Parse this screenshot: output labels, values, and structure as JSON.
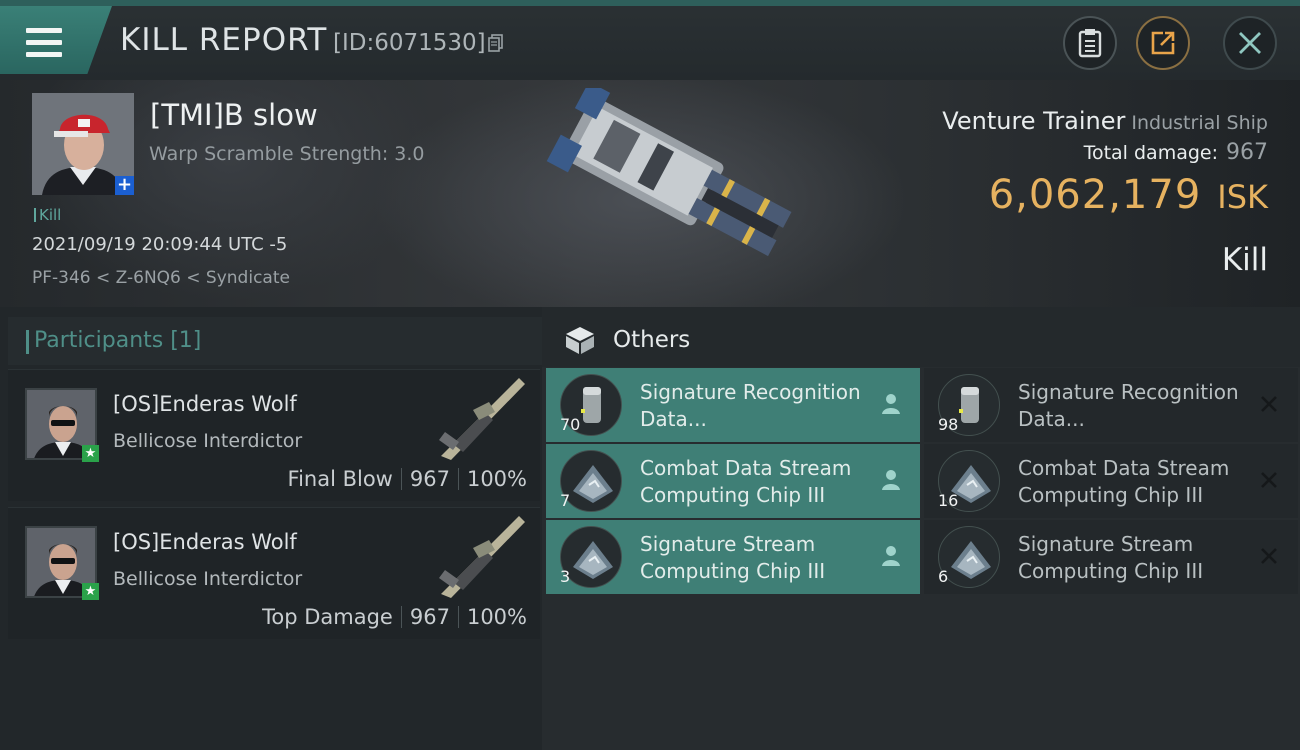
{
  "header": {
    "title": "KILL REPORT",
    "report_id": "[ID:6071530]"
  },
  "victim": {
    "name": "[TMI]B slow",
    "warp_scramble": "Warp Scramble Strength: 3.0",
    "kill_tag": "Kill",
    "timestamp": "2021/09/19 20:09:44 UTC -5",
    "location": "PF-346 < Z-6NQ6 < Syndicate",
    "plus_badge": "+"
  },
  "ship": {
    "name": "Venture Trainer",
    "class": "Industrial Ship",
    "total_damage_label": "Total damage:",
    "total_damage": "967",
    "isk_value": "6,062,179",
    "isk_unit": "ISK",
    "result": "Kill"
  },
  "participants": {
    "label": "Participants [1]",
    "cards": [
      {
        "name": "[OS]Enderas Wolf",
        "ship": "Bellicose Interdictor",
        "role": "Final Blow",
        "damage": "967",
        "percent": "100%"
      },
      {
        "name": "[OS]Enderas Wolf",
        "ship": "Bellicose Interdictor",
        "role": "Top Damage",
        "damage": "967",
        "percent": "100%"
      }
    ]
  },
  "others": {
    "label": "Others",
    "dropped": [
      {
        "name": "Signature Recognition Data...",
        "qty": "70",
        "icon": "data-canister-icon"
      },
      {
        "name": "Combat Data Stream Computing Chip III",
        "qty": "7",
        "icon": "chip-icon"
      },
      {
        "name": "Signature Stream Computing Chip III",
        "qty": "3",
        "icon": "chip-icon"
      }
    ],
    "destroyed": [
      {
        "name": "Signature Recognition Data...",
        "qty": "98",
        "icon": "data-canister-icon"
      },
      {
        "name": "Combat Data Stream Computing Chip III",
        "qty": "16",
        "icon": "chip-icon"
      },
      {
        "name": "Signature Stream Computing Chip III",
        "qty": "6",
        "icon": "chip-icon"
      }
    ]
  },
  "colors": {
    "accent_teal": "#3f7f76",
    "isk_gold": "#e6b260",
    "star_green": "#2aa24a",
    "plus_blue": "#1b5fd1"
  }
}
